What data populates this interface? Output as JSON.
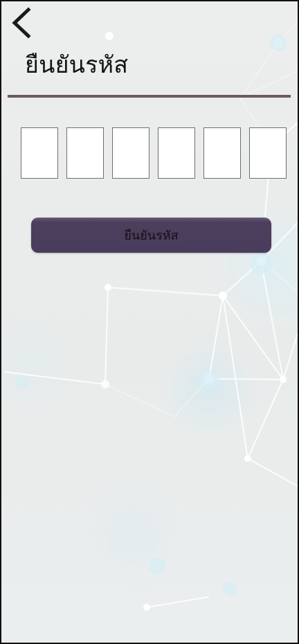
{
  "header": {
    "back_icon": "chevron-left-icon",
    "title": "ยืนยันรหัส"
  },
  "verification": {
    "code_boxes": [
      "",
      "",
      "",
      "",
      "",
      ""
    ]
  },
  "actions": {
    "confirm_label": "ยืนยันรหัส"
  },
  "colors": {
    "divider": "#6b5b5c",
    "button": "#4a3c5b",
    "background": "#eceded"
  }
}
